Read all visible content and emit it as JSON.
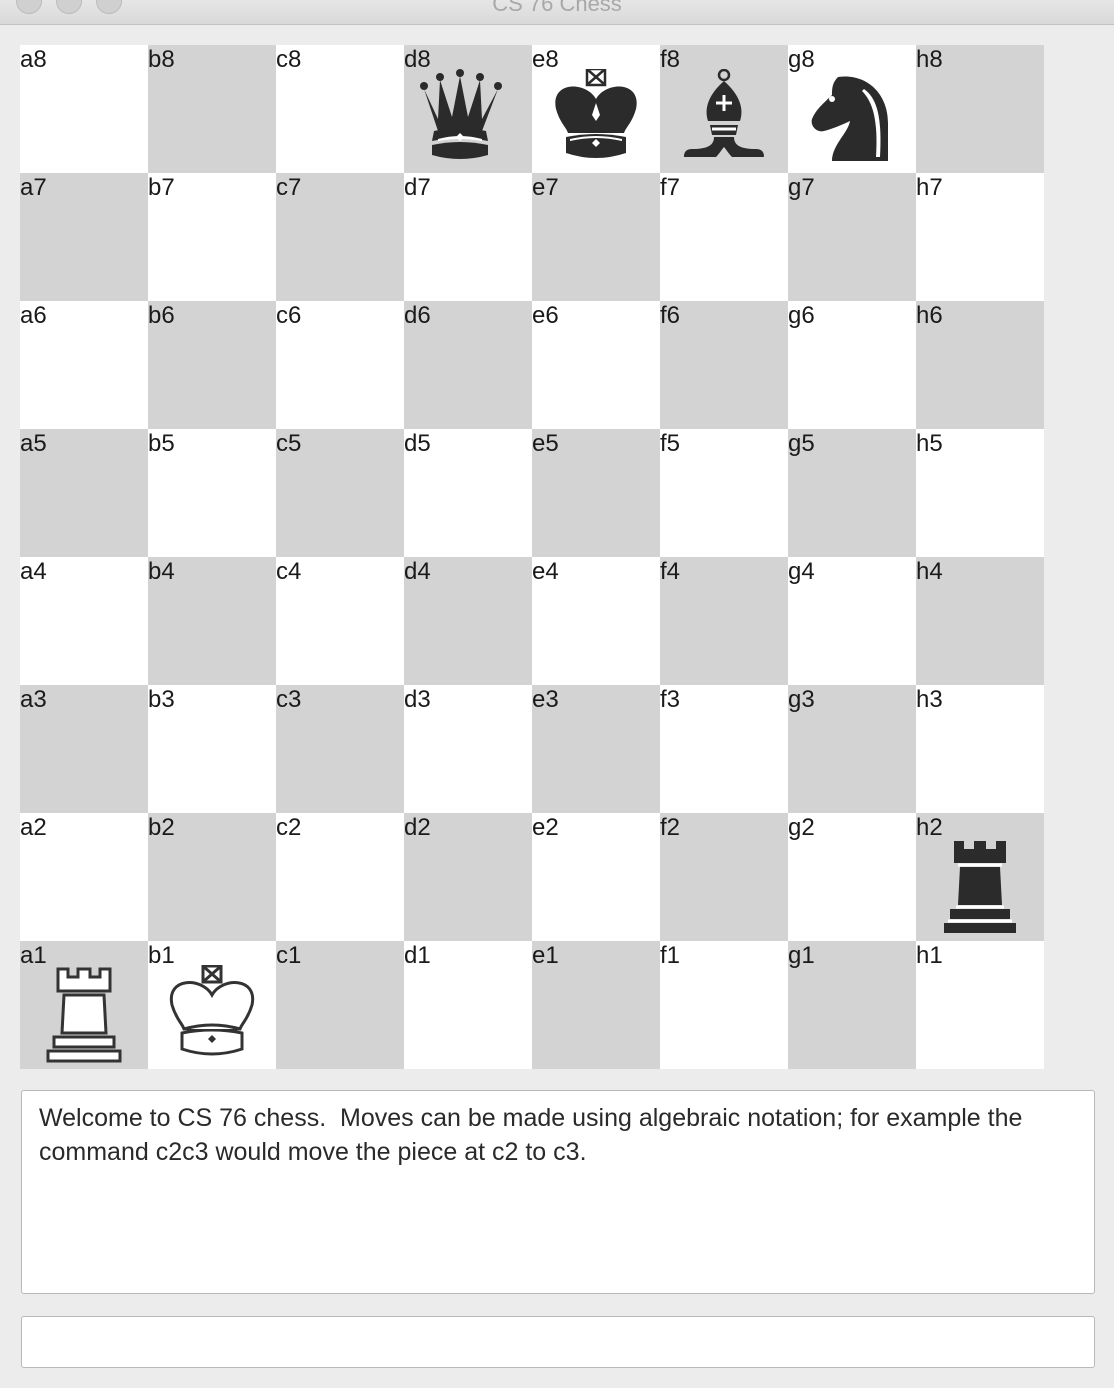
{
  "window": {
    "title": "CS 76 Chess"
  },
  "board": {
    "files": [
      "a",
      "b",
      "c",
      "d",
      "e",
      "f",
      "g",
      "h"
    ],
    "ranks": [
      "8",
      "7",
      "6",
      "5",
      "4",
      "3",
      "2",
      "1"
    ],
    "colors": {
      "light": "#ffffff",
      "dark": "#d3d3d3"
    },
    "pieces": {
      "d8": {
        "type": "queen",
        "color": "black",
        "icon": "black-queen-icon"
      },
      "e8": {
        "type": "king",
        "color": "black",
        "icon": "black-king-icon"
      },
      "f8": {
        "type": "bishop",
        "color": "black",
        "icon": "black-bishop-icon"
      },
      "g8": {
        "type": "knight",
        "color": "black",
        "icon": "black-knight-icon"
      },
      "h2": {
        "type": "rook",
        "color": "black",
        "icon": "black-rook-icon"
      },
      "a1": {
        "type": "rook",
        "color": "white",
        "icon": "white-rook-icon"
      },
      "b1": {
        "type": "king",
        "color": "white",
        "icon": "white-king-icon"
      }
    }
  },
  "log": {
    "text": "Welcome to CS 76 chess.  Moves can be made using algebraic notation; for example the command c2c3 would move the piece at c2 to c3."
  },
  "command": {
    "value": "",
    "placeholder": ""
  }
}
